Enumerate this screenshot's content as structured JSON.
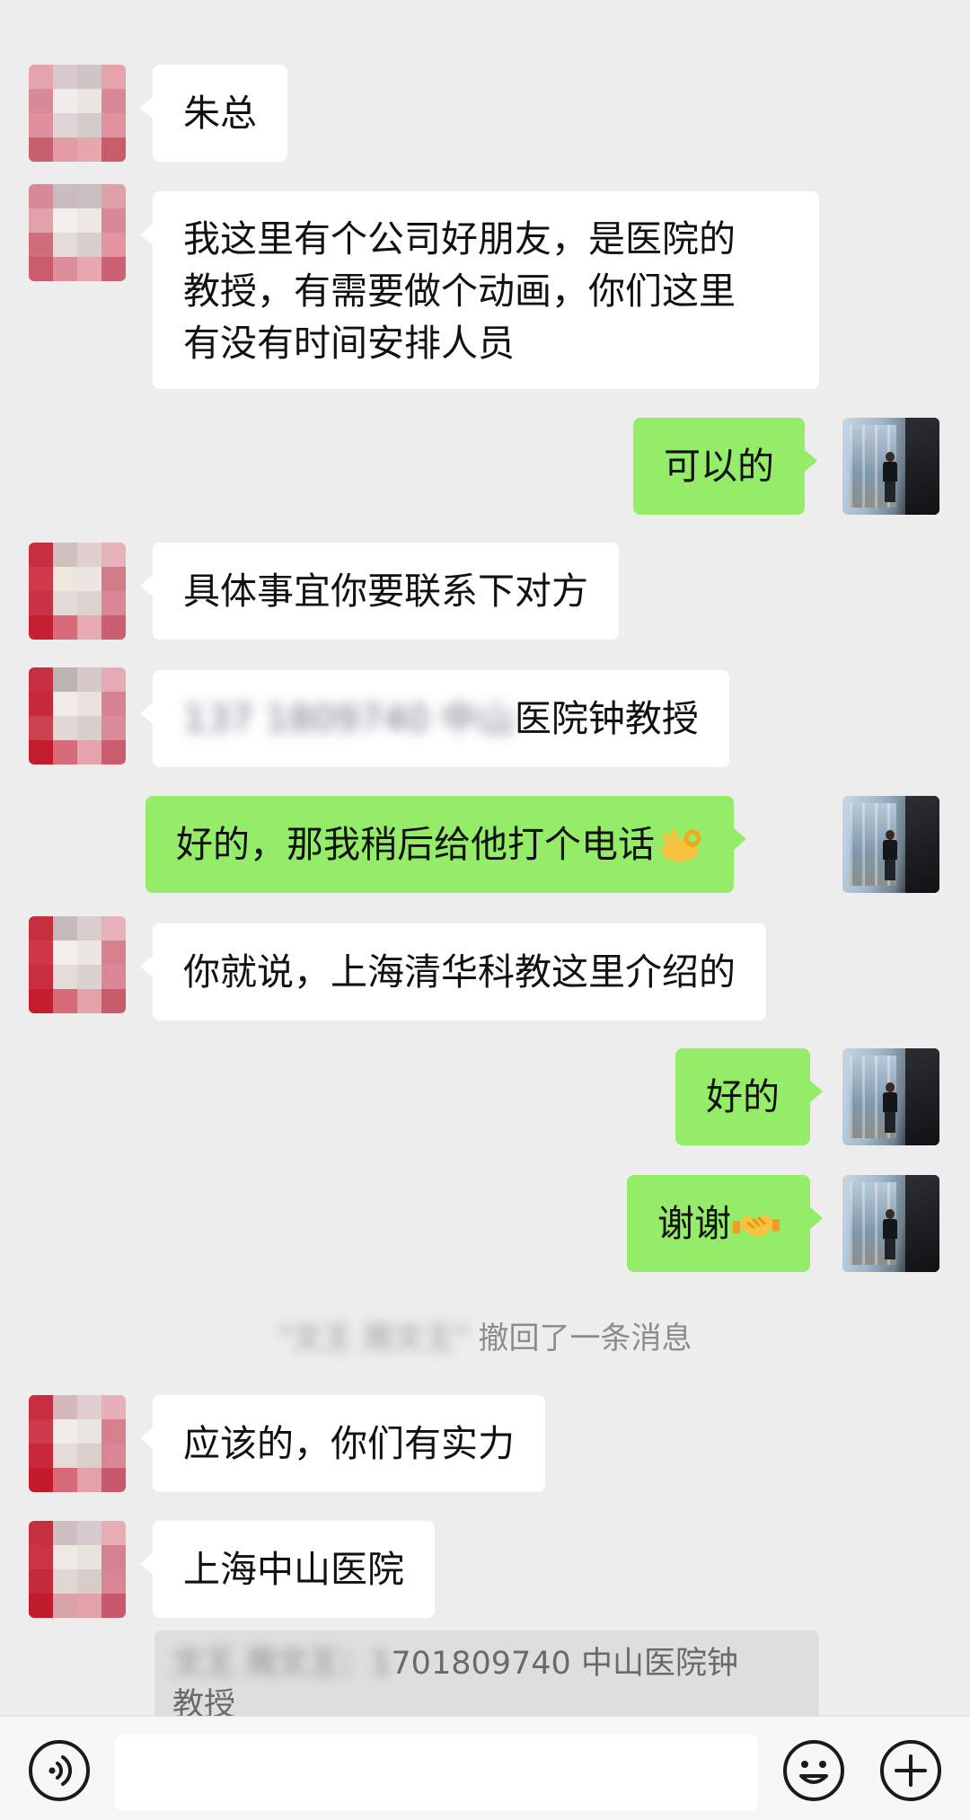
{
  "chat": {
    "messages": [
      {
        "id": "m1",
        "text": "朱总"
      },
      {
        "id": "m2",
        "lines": [
          "我这里有个公司好朋友，是医院的",
          "教授，有需要做个动画，你们这里",
          "有没有时间安排人员"
        ]
      },
      {
        "id": "m3",
        "text": "可以的"
      },
      {
        "id": "m4",
        "text": "具体事宜你要联系下对方"
      },
      {
        "id": "m5",
        "blurred": "137 1809740 中山",
        "text": "医院钟教授"
      },
      {
        "id": "m6",
        "text": "好的，那我稍后给他打个电话",
        "emoji": "ok-hand-emoji"
      },
      {
        "id": "m7",
        "text": "你就说，上海清华科教这里介绍的"
      },
      {
        "id": "m8",
        "text": "好的"
      },
      {
        "id": "m9",
        "text": "谢谢",
        "emoji": "handshake-emoji"
      },
      {
        "id": "m10",
        "text": "应该的，你们有实力"
      },
      {
        "id": "m11",
        "text": "上海中山医院"
      }
    ],
    "system_notice": {
      "blurred": "\"文王 周文王\"",
      "text": " 撤回了一条消息"
    },
    "quote": {
      "blurred": "文王 周文王：1",
      "line1_text": "701809740 中山医院钟",
      "line2_text": "教授"
    }
  },
  "input_bar": {
    "icons": [
      "voice-icon",
      "emoji-icon",
      "plus-icon"
    ]
  },
  "colors": {
    "background": "#ededed",
    "incoming_bubble": "#ffffff",
    "outgoing_bubble": "#95ec69",
    "input_bar": "#f7f7f7"
  }
}
